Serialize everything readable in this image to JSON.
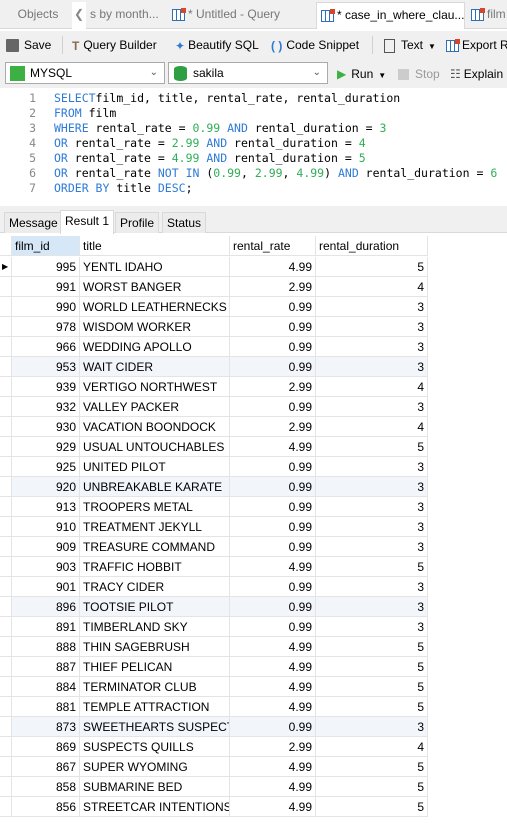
{
  "tabs": [
    {
      "label": "Objects"
    },
    {
      "label": "s by month..."
    },
    {
      "label": "* Untitled - Query"
    },
    {
      "label": "* case_in_where_clau..."
    },
    {
      "label": "film"
    }
  ],
  "toolbar": {
    "save": "Save",
    "query_builder": "Query Builder",
    "beautify": "Beautify SQL",
    "snippet": "Code Snippet",
    "text": "Text",
    "export": "Export R"
  },
  "connection": {
    "value": "MYSQL"
  },
  "database": {
    "value": "sakila"
  },
  "run": {
    "run": "Run",
    "stop": "Stop",
    "explain": "Explain"
  },
  "editor": {
    "lines": [
      {
        "n": "1",
        "tokens": [
          [
            "kw",
            "SELECT"
          ],
          [
            "",
            "film_id, title, rental_rate, rental_duration"
          ]
        ]
      },
      {
        "n": "2",
        "tokens": [
          [
            "kw",
            "FROM"
          ],
          [
            "",
            " film"
          ]
        ]
      },
      {
        "n": "3",
        "tokens": [
          [
            "kw",
            "WHERE"
          ],
          [
            "",
            " rental_rate = "
          ],
          [
            "num",
            "0.99"
          ],
          [
            "kw",
            " AND"
          ],
          [
            "",
            " rental_duration = "
          ],
          [
            "num",
            "3"
          ]
        ]
      },
      {
        "n": "4",
        "tokens": [
          [
            "kw",
            "OR"
          ],
          [
            "",
            " rental_rate = "
          ],
          [
            "num",
            "2.99"
          ],
          [
            "kw",
            " AND"
          ],
          [
            "",
            " rental_duration = "
          ],
          [
            "num",
            "4"
          ]
        ]
      },
      {
        "n": "5",
        "tokens": [
          [
            "kw",
            "OR"
          ],
          [
            "",
            " rental_rate = "
          ],
          [
            "num",
            "4.99"
          ],
          [
            "kw",
            " AND"
          ],
          [
            "",
            " rental_duration = "
          ],
          [
            "num",
            "5"
          ]
        ]
      },
      {
        "n": "6",
        "tokens": [
          [
            "kw",
            "OR"
          ],
          [
            "",
            " rental_rate "
          ],
          [
            "kw",
            "NOT IN"
          ],
          [
            "",
            " ("
          ],
          [
            "num",
            "0.99"
          ],
          [
            "",
            ", "
          ],
          [
            "num",
            "2.99"
          ],
          [
            "",
            ", "
          ],
          [
            "num",
            "4.99"
          ],
          [
            "",
            ") "
          ],
          [
            "kw",
            "AND"
          ],
          [
            "",
            " rental_duration = "
          ],
          [
            "num",
            "6"
          ]
        ]
      },
      {
        "n": "7",
        "tokens": [
          [
            "kw",
            "ORDER BY"
          ],
          [
            "",
            " title "
          ],
          [
            "kw",
            "DESC"
          ],
          [
            "",
            ";"
          ]
        ]
      }
    ]
  },
  "result_tabs": [
    "Message",
    "Result 1",
    "Profile",
    "Status"
  ],
  "columns": [
    "film_id",
    "title",
    "rental_rate",
    "rental_duration"
  ],
  "rows": [
    [
      "995",
      "YENTL IDAHO",
      "4.99",
      "5"
    ],
    [
      "991",
      "WORST BANGER",
      "2.99",
      "4"
    ],
    [
      "990",
      "WORLD LEATHERNECKS",
      "0.99",
      "3"
    ],
    [
      "978",
      "WISDOM WORKER",
      "0.99",
      "3"
    ],
    [
      "966",
      "WEDDING APOLLO",
      "0.99",
      "3"
    ],
    [
      "953",
      "WAIT CIDER",
      "0.99",
      "3"
    ],
    [
      "939",
      "VERTIGO NORTHWEST",
      "2.99",
      "4"
    ],
    [
      "932",
      "VALLEY PACKER",
      "0.99",
      "3"
    ],
    [
      "930",
      "VACATION BOONDOCK",
      "2.99",
      "4"
    ],
    [
      "929",
      "USUAL UNTOUCHABLES",
      "4.99",
      "5"
    ],
    [
      "925",
      "UNITED PILOT",
      "0.99",
      "3"
    ],
    [
      "920",
      "UNBREAKABLE KARATE",
      "0.99",
      "3"
    ],
    [
      "913",
      "TROOPERS METAL",
      "0.99",
      "3"
    ],
    [
      "910",
      "TREATMENT JEKYLL",
      "0.99",
      "3"
    ],
    [
      "909",
      "TREASURE COMMAND",
      "0.99",
      "3"
    ],
    [
      "903",
      "TRAFFIC HOBBIT",
      "4.99",
      "5"
    ],
    [
      "901",
      "TRACY CIDER",
      "0.99",
      "3"
    ],
    [
      "896",
      "TOOTSIE PILOT",
      "0.99",
      "3"
    ],
    [
      "891",
      "TIMBERLAND SKY",
      "0.99",
      "3"
    ],
    [
      "888",
      "THIN SAGEBRUSH",
      "4.99",
      "5"
    ],
    [
      "887",
      "THIEF PELICAN",
      "4.99",
      "5"
    ],
    [
      "884",
      "TERMINATOR CLUB",
      "4.99",
      "5"
    ],
    [
      "881",
      "TEMPLE ATTRACTION",
      "4.99",
      "5"
    ],
    [
      "873",
      "SWEETHEARTS SUSPECTS",
      "0.99",
      "3"
    ],
    [
      "869",
      "SUSPECTS QUILLS",
      "2.99",
      "4"
    ],
    [
      "867",
      "SUPER WYOMING",
      "4.99",
      "5"
    ],
    [
      "858",
      "SUBMARINE BED",
      "4.99",
      "5"
    ],
    [
      "856",
      "STREETCAR INTENTIONS",
      "4.99",
      "5"
    ]
  ],
  "tinted_rows": [
    "953",
    "920",
    "896",
    "873"
  ],
  "colors": {
    "keyword": "#2e7bd6",
    "number": "#2fae57",
    "run": "#3cb043",
    "selected_header": "#d6e7f7"
  }
}
